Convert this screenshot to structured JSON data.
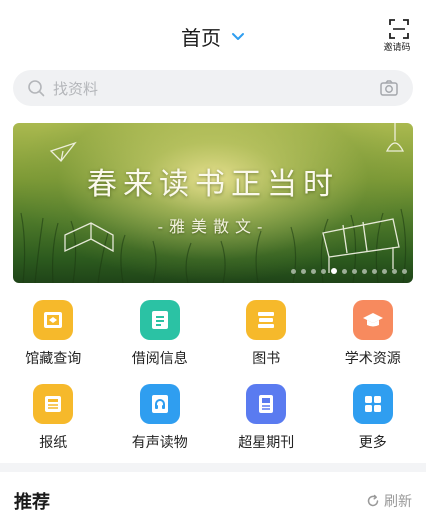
{
  "header": {
    "title": "首页",
    "scan_label": "邀请码"
  },
  "search": {
    "placeholder": "找资料"
  },
  "banner": {
    "main_text": "春来读书正当时",
    "sub_text": "-雅美散文-",
    "slide_count": 12,
    "active_slide": 5
  },
  "grid": [
    {
      "label": "馆藏查询",
      "icon": "library-icon",
      "color": "#f6b92b"
    },
    {
      "label": "借阅信息",
      "icon": "borrow-list-icon",
      "color": "#2bc2a4"
    },
    {
      "label": "图书",
      "icon": "books-icon",
      "color": "#f6b92b"
    },
    {
      "label": "学术资源",
      "icon": "graduation-cap-icon",
      "color": "#f78a5e"
    },
    {
      "label": "报纸",
      "icon": "newspaper-icon",
      "color": "#f6b92b"
    },
    {
      "label": "有声读物",
      "icon": "headphones-icon",
      "color": "#2f9ef0"
    },
    {
      "label": "超星期刊",
      "icon": "journal-icon",
      "color": "#5a7bf0"
    },
    {
      "label": "更多",
      "icon": "more-grid-icon",
      "color": "#2f9ef0"
    }
  ],
  "recommend": {
    "title": "推荐",
    "refresh_label": "刷新"
  }
}
